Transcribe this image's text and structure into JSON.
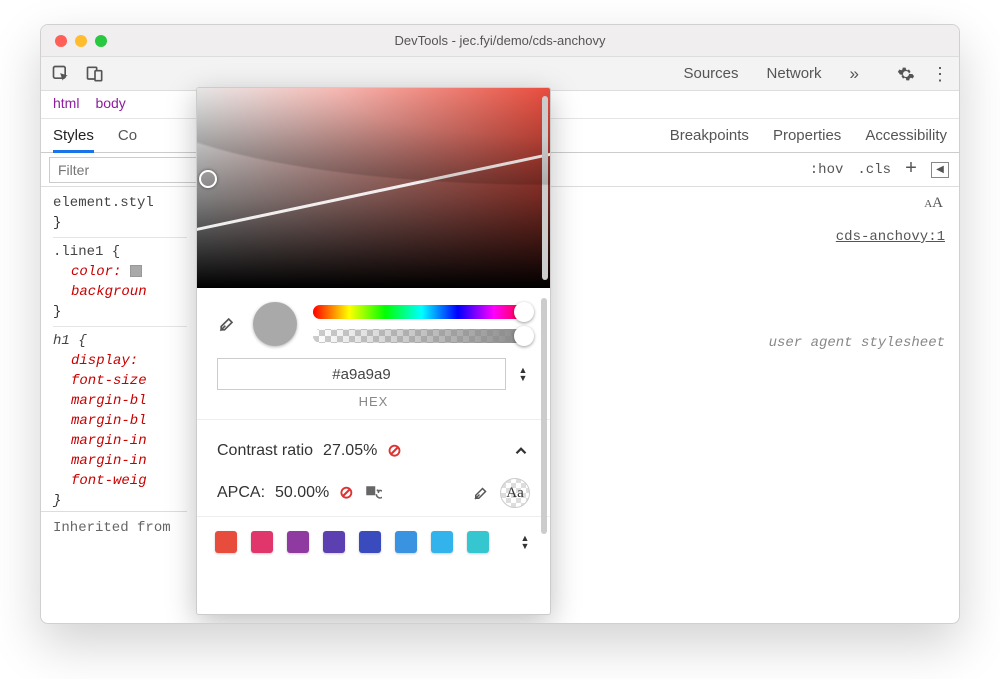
{
  "window": {
    "title": "DevTools - jec.fyi/demo/cds-anchovy"
  },
  "toolbar": {
    "tabs": {
      "sources": "Sources",
      "network": "Network"
    }
  },
  "crumbs": {
    "html": "html",
    "body": "body"
  },
  "subtabs": {
    "styles": "Styles",
    "computed": "Co",
    "breakpoints": "Breakpoints",
    "properties": "Properties",
    "accessibility": "Accessibility"
  },
  "filter": {
    "placeholder": "Filter",
    "hov": ":hov",
    "cls": ".cls"
  },
  "styles": {
    "element_style": "element.styl",
    "brace_close": "}",
    "line1_sel": ".line1 {",
    "line1_color": "color:",
    "line1_bg": "backgroun",
    "h1_sel": "h1 {",
    "h1_props": {
      "display": "display:",
      "font_size": "font-size",
      "margin_bl1": "margin-bl",
      "margin_bl2": "margin-bl",
      "margin_in1": "margin-in",
      "margin_in2": "margin-in",
      "font_weig": "font-weig"
    },
    "inherited": "Inherited from"
  },
  "right": {
    "aa": "AA",
    "link": "cds-anchovy:1",
    "uas": "user agent stylesheet"
  },
  "picker": {
    "hex_value": "#a9a9a9",
    "format": "HEX",
    "contrast_label": "Contrast ratio",
    "contrast_value": "27.05%",
    "apca_label": "APCA:",
    "apca_value": "50.00%",
    "preview_aa": "Aa",
    "palette": [
      "#e84c3d",
      "#e0366b",
      "#8e3aa0",
      "#5c3fb0",
      "#3a4bbd",
      "#3a93e0",
      "#33b3ec",
      "#36c6cf"
    ]
  }
}
